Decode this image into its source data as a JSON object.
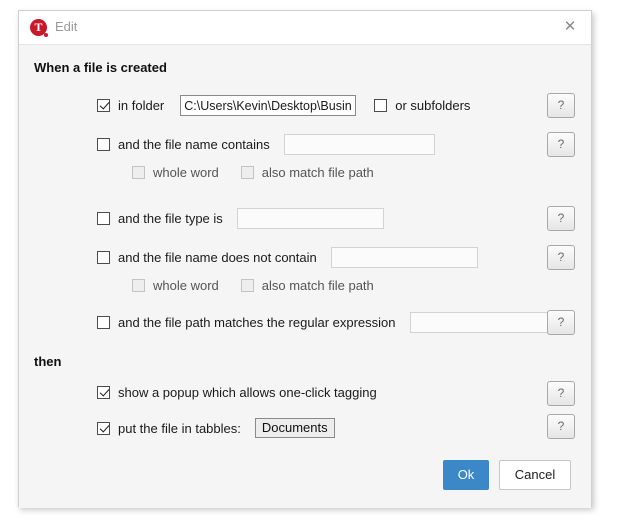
{
  "window": {
    "logo_glyph": "T",
    "title": "Edit",
    "close_glyph": "✕"
  },
  "sections": {
    "when_header": "When a file is created",
    "then_header": "then"
  },
  "help_label": "?",
  "rules": {
    "in_folder": {
      "label": "in folder",
      "checked": true,
      "path_value": "C:\\Users\\Kevin\\Desktop\\Business",
      "subfolders_label": "or subfolders",
      "subfolders_checked": false
    },
    "name_contains": {
      "label": "and the file name contains",
      "checked": false,
      "value": "",
      "whole_word_label": "whole word",
      "whole_word_checked": false,
      "match_path_label": "also match file path",
      "match_path_checked": false
    },
    "file_type": {
      "label": "and the file type is",
      "checked": false,
      "value": ""
    },
    "name_not_contains": {
      "label": "and the file name does not contain",
      "checked": false,
      "value": "",
      "whole_word_label": "whole word",
      "whole_word_checked": false,
      "match_path_label": "also match file path",
      "match_path_checked": false
    },
    "regex": {
      "label": "and the file path matches the regular expression",
      "checked": false,
      "value": ""
    }
  },
  "actions": {
    "popup": {
      "label": "show a popup which allows one-click tagging",
      "checked": true
    },
    "put_in_tabbles": {
      "label": "put the file in tabbles:",
      "checked": true,
      "tabble_name": "Documents"
    }
  },
  "footer": {
    "ok_label": "Ok",
    "cancel_label": "Cancel"
  },
  "colors": {
    "accent": "#3b87c8",
    "logo": "#c9182b",
    "window_bg": "#f5f5f5"
  }
}
